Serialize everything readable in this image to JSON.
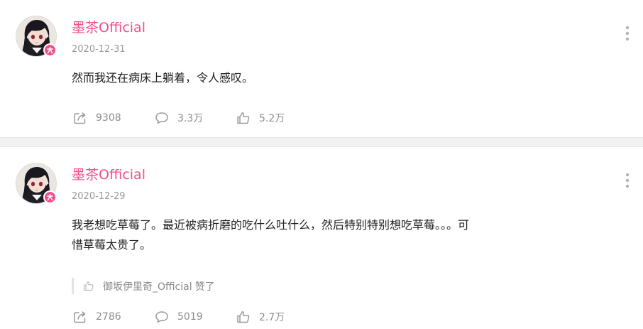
{
  "posts": [
    {
      "username": "墨茶Official",
      "date": "2020-12-31",
      "content": "然而我还在病床上躺着，令人感叹。",
      "actions": {
        "share": "9308",
        "comment": "3.3万",
        "like": "5.2万"
      }
    },
    {
      "username": "墨茶Official",
      "date": "2020-12-29",
      "content_line1": "我老想吃草莓了。最近被病折磨的吃什么吐什么，然后特别特别想吃草莓。。。可",
      "content_line2": "惜草莓太贵了。",
      "liked_by": {
        "user": "御坂伊里奇_Official",
        "verb": "赞了"
      },
      "actions": {
        "share": "2786",
        "comment": "5019",
        "like": "2.7万"
      }
    }
  ],
  "icons": {
    "avatar": "anime-avatar-image",
    "badge": "vip-badge-icon",
    "more": "more-vertical-icon",
    "share": "share-icon",
    "comment": "comment-icon",
    "like": "thumbs-up-icon"
  },
  "colors": {
    "username": "#f0508a",
    "badge": "#f0508a",
    "meta": "#999999",
    "separator": "#f2f2f5"
  }
}
